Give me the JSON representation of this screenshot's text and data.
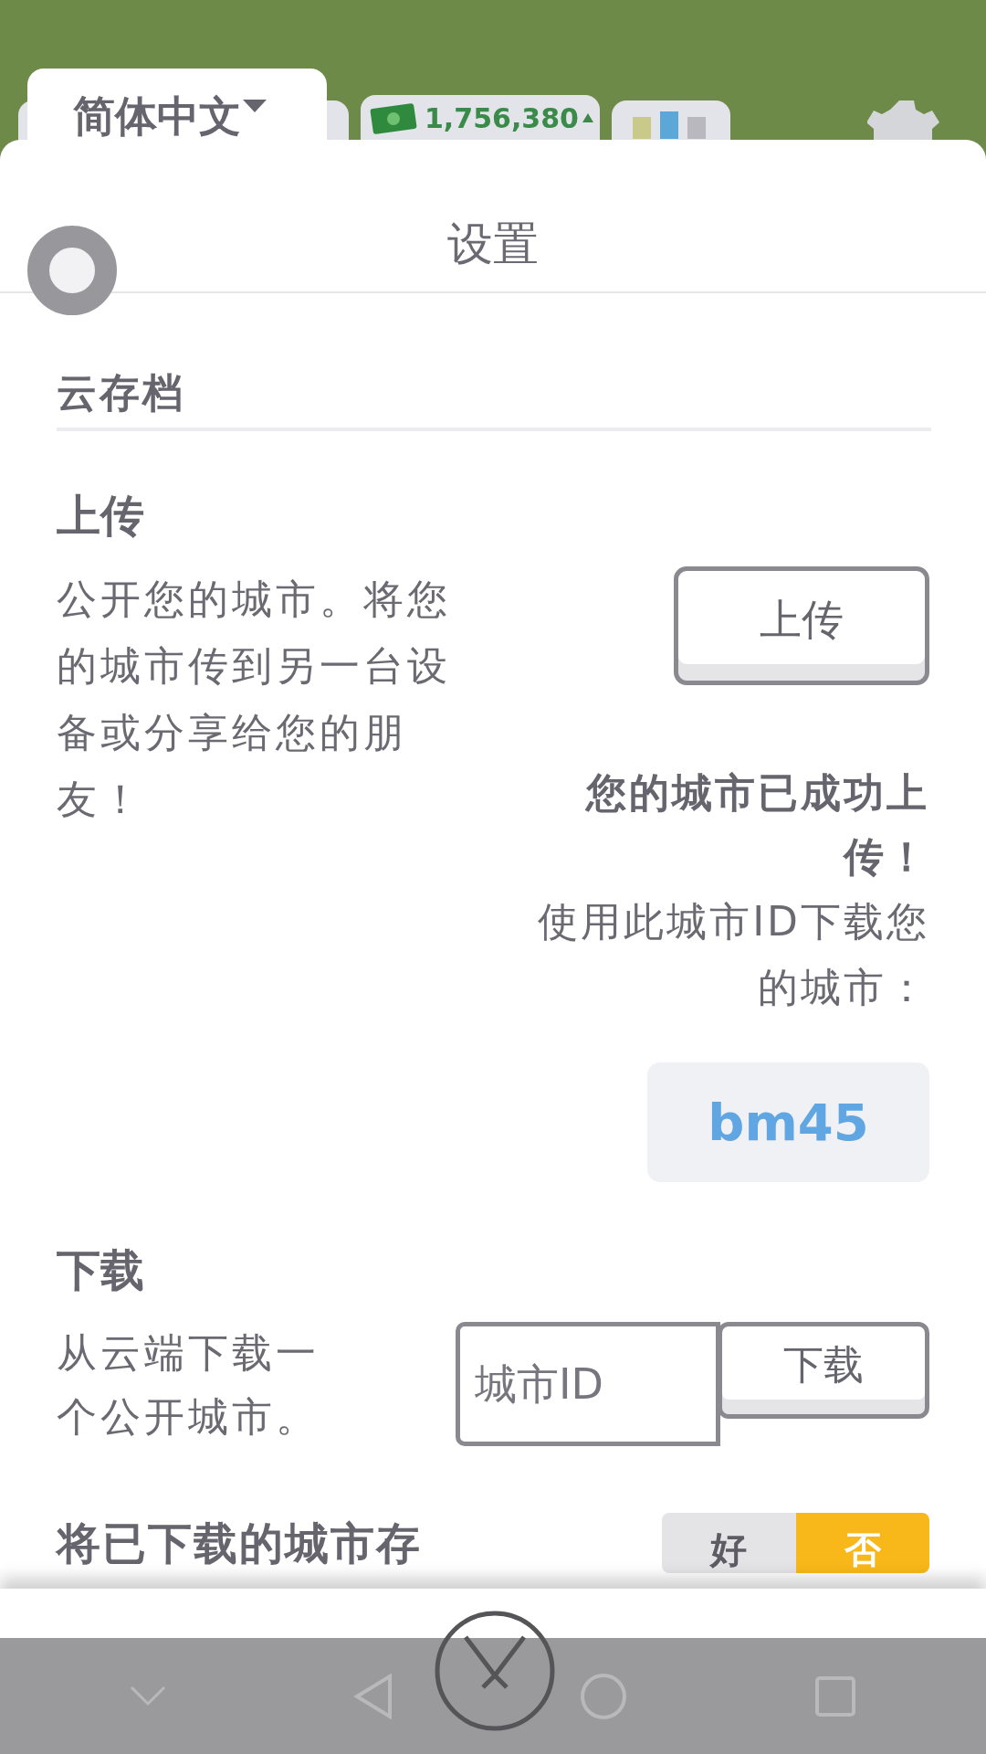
{
  "language_tab": {
    "label": "简体中文"
  },
  "top_bar": {
    "money": "1,756,380"
  },
  "title": "设置",
  "section": "云存档",
  "upload": {
    "heading": "上传",
    "description": "公开您的城市。将您的城市传到另一台设备或分享给您的朋友！",
    "button": "上传",
    "success": "您的城市已成功上传！",
    "instruction": "使用此城市ID下载您的城市：",
    "city_id": "bm45"
  },
  "download": {
    "heading": "下载",
    "description": "从云端下载一个公开城市。",
    "placeholder": "城市ID",
    "button": "下载"
  },
  "save_option": {
    "label": "将已下载的城市存",
    "options": [
      {
        "label": "好",
        "selected": false
      },
      {
        "label": "否",
        "selected": true
      }
    ]
  }
}
